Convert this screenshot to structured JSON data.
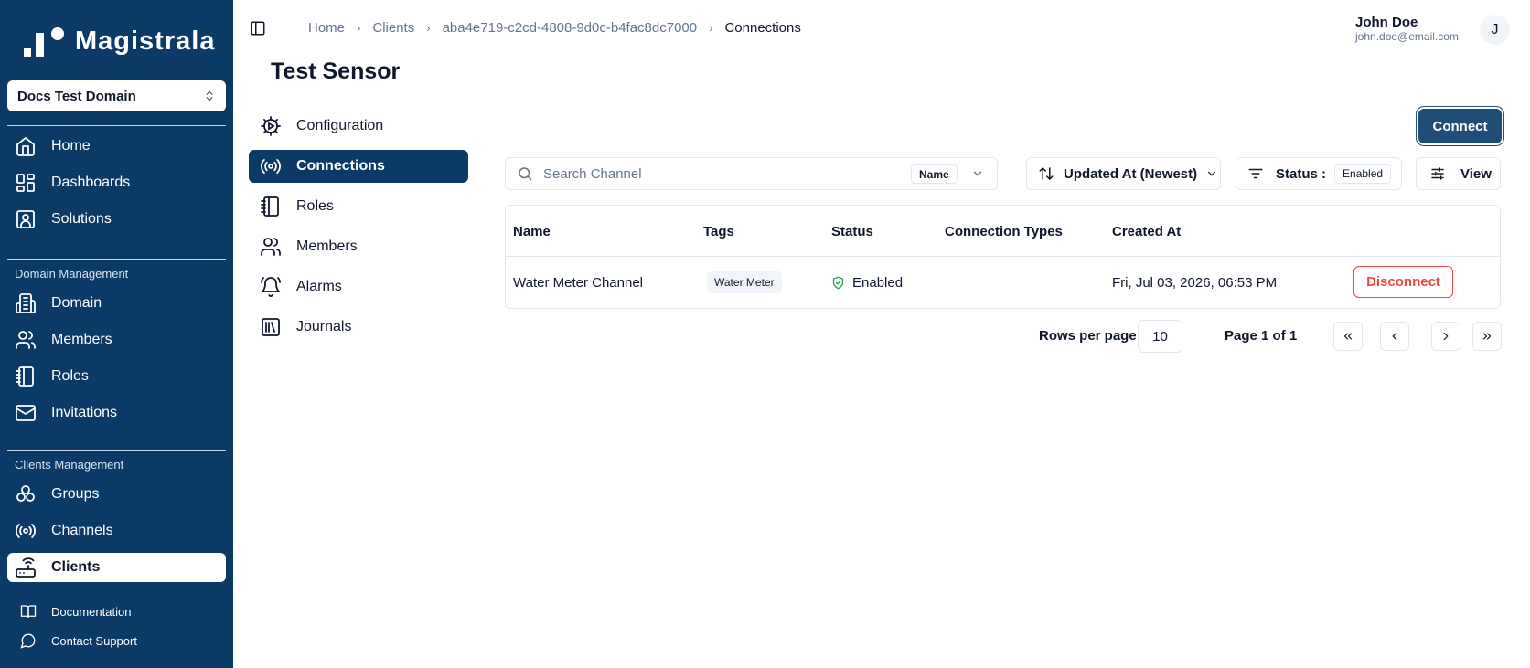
{
  "app": {
    "name": "Magistrala",
    "domain_selector": "Docs Test Domain"
  },
  "sidebar": {
    "main_items": [
      {
        "label": "Home",
        "icon": "home-icon"
      },
      {
        "label": "Dashboards",
        "icon": "dashboard-icon"
      },
      {
        "label": "Solutions",
        "icon": "solutions-icon"
      }
    ],
    "domain_section": {
      "label": "Domain Management",
      "items": [
        {
          "label": "Domain",
          "icon": "building-icon"
        },
        {
          "label": "Members",
          "icon": "users-icon"
        },
        {
          "label": "Roles",
          "icon": "notebook-icon"
        },
        {
          "label": "Invitations",
          "icon": "mail-icon"
        }
      ]
    },
    "clients_section": {
      "label": "Clients Management",
      "items": [
        {
          "label": "Groups",
          "icon": "groups-icon"
        },
        {
          "label": "Channels",
          "icon": "radio-icon"
        },
        {
          "label": "Clients",
          "icon": "router-icon",
          "active": true
        }
      ]
    },
    "footer_items": [
      {
        "label": "Documentation",
        "icon": "book-icon"
      },
      {
        "label": "Contact Support",
        "icon": "message-icon"
      }
    ]
  },
  "header": {
    "breadcrumb": [
      "Home",
      "Clients",
      "aba4e719-c2cd-4808-9d0c-b4fac8dc7000",
      "Connections"
    ],
    "user_name": "John Doe",
    "user_email": "john.doe@email.com",
    "avatar_initial": "J"
  },
  "page": {
    "title": "Test Sensor"
  },
  "subnav": [
    {
      "label": "Configuration",
      "icon": "cog-icon"
    },
    {
      "label": "Connections",
      "icon": "radio-icon",
      "active": true
    },
    {
      "label": "Roles",
      "icon": "notebook-icon"
    },
    {
      "label": "Members",
      "icon": "users-icon"
    },
    {
      "label": "Alarms",
      "icon": "bell-icon"
    },
    {
      "label": "Journals",
      "icon": "library-icon"
    }
  ],
  "toolbar": {
    "connect_label": "Connect",
    "search_placeholder": "Search Channel",
    "search_field": "Name",
    "sort_label": "Updated At (Newest)",
    "status_label": "Status :",
    "status_value": "Enabled",
    "view_label": "View"
  },
  "table": {
    "columns": [
      "Name",
      "Tags",
      "Status",
      "Connection Types",
      "Created At"
    ],
    "rows": [
      {
        "name": "Water Meter Channel",
        "tags": "Water Meter",
        "status": "Enabled",
        "connection_types": "",
        "created_at": "Fri, Jul 03, 2026, 06:53 PM",
        "action": "Disconnect"
      }
    ]
  },
  "pagination": {
    "rows_per_page_label": "Rows per page",
    "rows_per_page": "10",
    "page_label": "Page 1 of 1"
  },
  "colors": {
    "sidebar_bg": "#0b3a66",
    "primary": "#1e4d78",
    "danger": "#ef4444",
    "status_ok": "#16a34a",
    "border": "#e2e8f0",
    "muted_text": "#64748b"
  }
}
